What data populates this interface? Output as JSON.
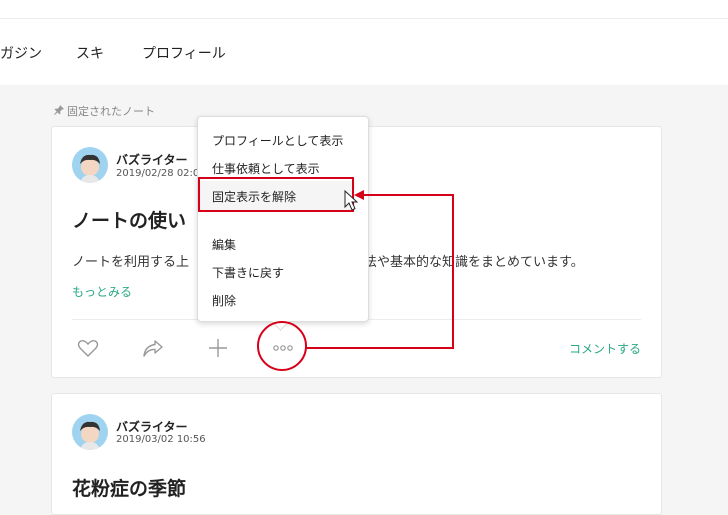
{
  "nav": {
    "items": [
      "ガジン",
      "スキ",
      "プロフィール"
    ]
  },
  "pinned_label": "固定されたノート",
  "cards": [
    {
      "author": "バズライター",
      "date": "2019/02/28 02:0",
      "title": "ノートの使い",
      "body": "ノートを利用する上",
      "body_tail": "方法や基本的な知識をまとめています。",
      "more": "もっとみる",
      "comment": "コメントする"
    },
    {
      "author": "バズライター",
      "date": "2019/03/02 10:56",
      "title": "花粉症の季節"
    }
  ],
  "menu": {
    "items": [
      "プロフィールとして表示",
      "仕事依頼として表示",
      "固定表示を解除",
      "編集",
      "下書きに戻す",
      "削除"
    ]
  },
  "icons": [
    "pin-icon",
    "heart-icon",
    "share-icon",
    "plus-icon",
    "more-icon",
    "mouse-cursor-icon"
  ],
  "colors": {
    "accent": "#2aa884",
    "annotation": "#d7001a"
  }
}
